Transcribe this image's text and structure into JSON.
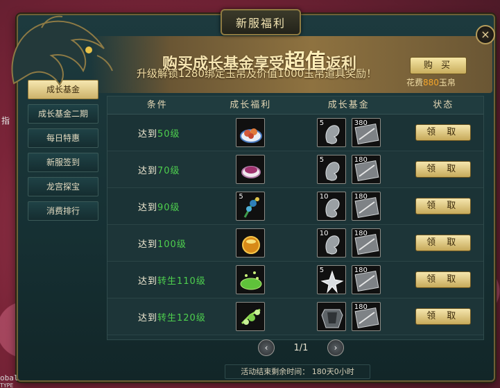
{
  "window": {
    "title": "新服福利",
    "close_icon": "×"
  },
  "banner": {
    "title_prefix": "购买成长基金享受",
    "title_big": "超值",
    "title_suffix": "返利",
    "subtitle": "升级解锁1280绑定玉帛及价值1000玉帛道具奖励！",
    "buy_label": "购 买",
    "cost_prefix": "花费",
    "cost_value": "880",
    "cost_suffix": "玉帛"
  },
  "sidebar": {
    "items": [
      {
        "label": "成长基金",
        "active": true
      },
      {
        "label": "成长基金二期",
        "active": false
      },
      {
        "label": "每日特惠",
        "active": false
      },
      {
        "label": "新服签到",
        "active": false
      },
      {
        "label": "龙宫探宝",
        "active": false
      },
      {
        "label": "消费排行",
        "active": false
      }
    ]
  },
  "table": {
    "headers": [
      "条件",
      "成长福利",
      "成长基金",
      "状态"
    ],
    "rows": [
      {
        "cond_prefix": "达到",
        "level": "50级",
        "reward_icon": "dumpling-plate-icon",
        "reward_count": "",
        "fund": [
          {
            "icon": "jade-spirit-icon",
            "count": "5"
          },
          {
            "icon": "scroll-bundle-icon",
            "count": "380"
          }
        ],
        "status": "领 取"
      },
      {
        "cond_prefix": "达到",
        "level": "70级",
        "reward_icon": "purple-bowl-icon",
        "reward_count": "",
        "fund": [
          {
            "icon": "jade-spirit-icon",
            "count": "5"
          },
          {
            "icon": "scroll-bundle-icon",
            "count": "180"
          }
        ],
        "status": "领 取"
      },
      {
        "cond_prefix": "达到",
        "level": "90级",
        "reward_icon": "herb-bundle-icon",
        "reward_count": "5",
        "fund": [
          {
            "icon": "jade-spirit-icon",
            "count": "10"
          },
          {
            "icon": "scroll-bundle-icon",
            "count": "180"
          }
        ],
        "status": "领 取"
      },
      {
        "cond_prefix": "达到",
        "level": "100级",
        "reward_icon": "golden-pot-icon",
        "reward_count": "",
        "fund": [
          {
            "icon": "jade-spirit-icon",
            "count": "10"
          },
          {
            "icon": "scroll-bundle-icon",
            "count": "180"
          }
        ],
        "status": "领 取"
      },
      {
        "cond_prefix": "达到",
        "level": "转生110级",
        "reward_icon": "green-leaf-plate-icon",
        "reward_count": "",
        "fund": [
          {
            "icon": "crystal-cluster-icon",
            "count": "5"
          },
          {
            "icon": "scroll-bundle-icon",
            "count": "180"
          }
        ],
        "status": "领 取"
      },
      {
        "cond_prefix": "达到",
        "level": "转生120级",
        "reward_icon": "green-sparkle-icon",
        "reward_count": "",
        "fund": [
          {
            "icon": "armor-icon",
            "count": ""
          },
          {
            "icon": "scroll-bundle-icon",
            "count": "180"
          }
        ],
        "status": "领 取"
      }
    ]
  },
  "pager": {
    "prev_icon": "‹",
    "next_icon": "›",
    "text": "1/1"
  },
  "timer": {
    "text": "活动结束剩余时间： 180天0小时"
  },
  "overlay": {
    "fragment_text": "指",
    "bottom_text_1": "obal",
    "bottom_text_2": "TYPE"
  },
  "colors": {
    "accent_gold": "#f5e6ae",
    "level_green": "#4ed04e",
    "cost_orange": "#f5a62a"
  }
}
